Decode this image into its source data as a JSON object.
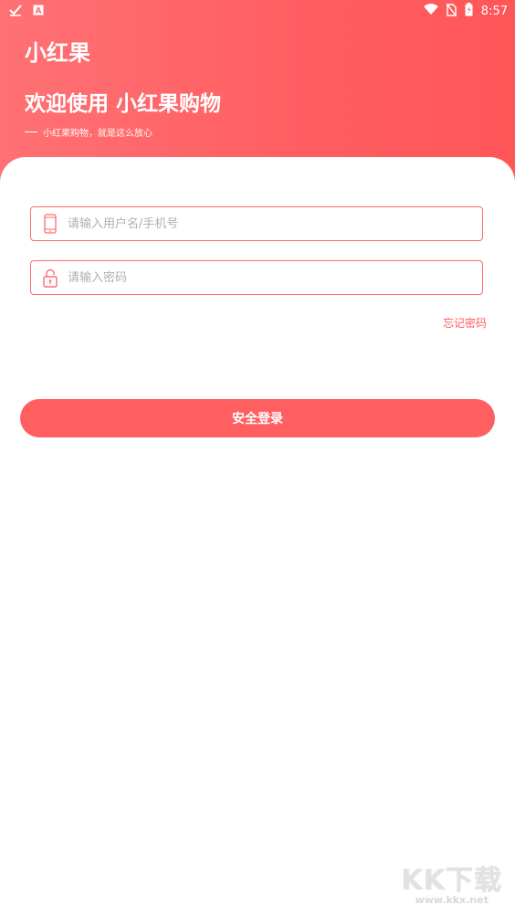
{
  "status_bar": {
    "time": "8:57",
    "left_icons": [
      "check-icon",
      "a-box-icon"
    ],
    "right_icons": [
      "wifi-icon",
      "no-sim-icon",
      "battery-icon"
    ]
  },
  "header": {
    "app_name": "小红果",
    "welcome": "欢迎使用 小红果购物",
    "slogan": "小红果购物，就是这么放心"
  },
  "form": {
    "username_placeholder": "请输入用户名/手机号",
    "username_icon": "phone-icon",
    "password_placeholder": "请输入密码",
    "password_icon": "lock-icon",
    "forgot_label": "忘记密码",
    "login_label": "安全登录"
  },
  "watermark": {
    "logo_text": "KK下载",
    "url": "www.kkx.net"
  },
  "colors": {
    "accent": "#ff5f61",
    "header_gradient_start": "#ff7174",
    "header_gradient_end": "#ff5658"
  }
}
